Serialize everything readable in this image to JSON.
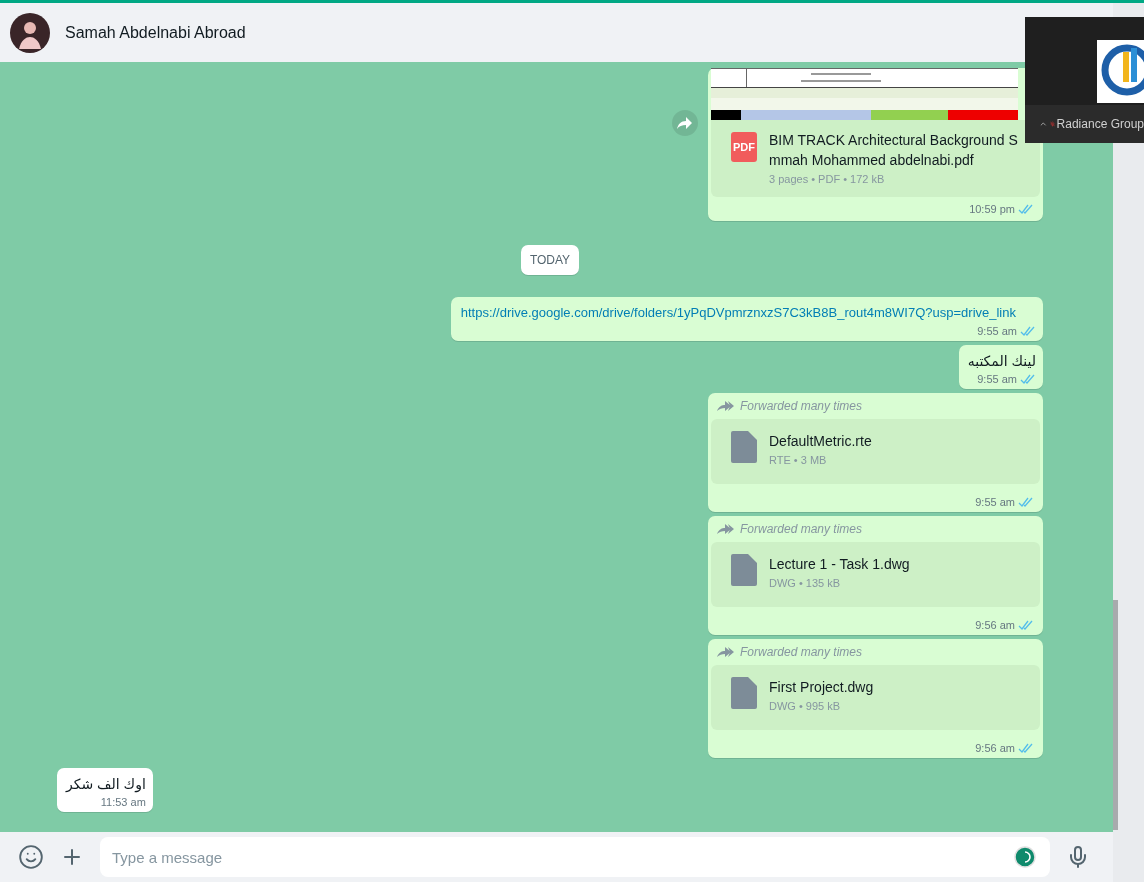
{
  "header": {
    "name": "Samah Abdelnabi Abroad"
  },
  "overlay": {
    "label": "Radiance Group"
  },
  "messages": [
    {
      "kind": "document",
      "outgoing": true,
      "icon_label": "PDF",
      "name": "BIM TRACK Architectural Background S mmah Mohammed abdelnabi.pdf",
      "meta": "3 pages • PDF • 172 kB",
      "time": "10:59 pm",
      "read": true
    },
    {
      "kind": "date",
      "label": "TODAY"
    },
    {
      "kind": "link",
      "outgoing": true,
      "text": "https://drive.google.com/drive/folders/1yPqDVpmrznxzS7C3kB8B_rout4m8WI7Q?usp=drive_link",
      "time": "9:55 am",
      "read": true
    },
    {
      "kind": "text",
      "outgoing": true,
      "text": "لينك المكتبه",
      "time": "9:55 am",
      "read": true
    },
    {
      "kind": "file",
      "outgoing": true,
      "forward_note": "Forwarded many times",
      "name": "DefaultMetric.rte",
      "meta": "RTE • 3 MB",
      "time": "9:55 am",
      "read": true
    },
    {
      "kind": "file",
      "outgoing": true,
      "forward_note": "Forwarded many times",
      "name": "Lecture 1 - Task 1.dwg",
      "meta": "DWG • 135 kB",
      "time": "9:56 am",
      "read": true
    },
    {
      "kind": "file",
      "outgoing": true,
      "forward_note": "Forwarded many times",
      "name": "First Project.dwg",
      "meta": "DWG • 995 kB",
      "time": "9:56 am",
      "read": true
    },
    {
      "kind": "text",
      "outgoing": false,
      "text": "اوك الف شكر",
      "time": "11:53 am"
    }
  ],
  "composer": {
    "placeholder": "Type a message"
  }
}
